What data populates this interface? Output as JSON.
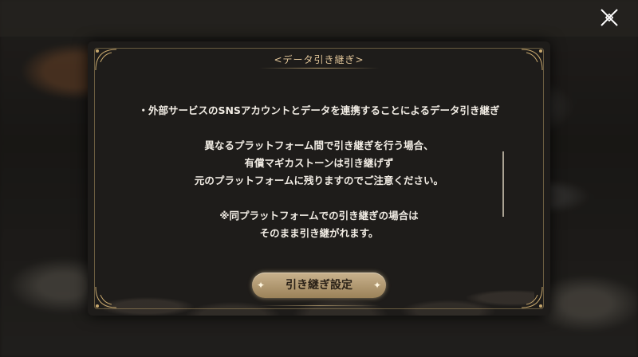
{
  "dialog": {
    "title": "<データ引き継ぎ>",
    "paragraphs": [
      "・外部サービスのSNSアカウントとデータを連携することによるデータ引き継ぎ",
      "異なるプラットフォーム間で引き継ぎを行う場合、",
      "有償マギカストーンは引き継げず",
      "元のプラットフォームに残りますのでご注意ください。",
      "※同プラットフォームでの引き継ぎの場合は",
      "そのまま引き継がれます。"
    ],
    "action_button_label": "引き継ぎ設定",
    "close_icon": "close-icon",
    "accent_color": "#e3c79a"
  }
}
